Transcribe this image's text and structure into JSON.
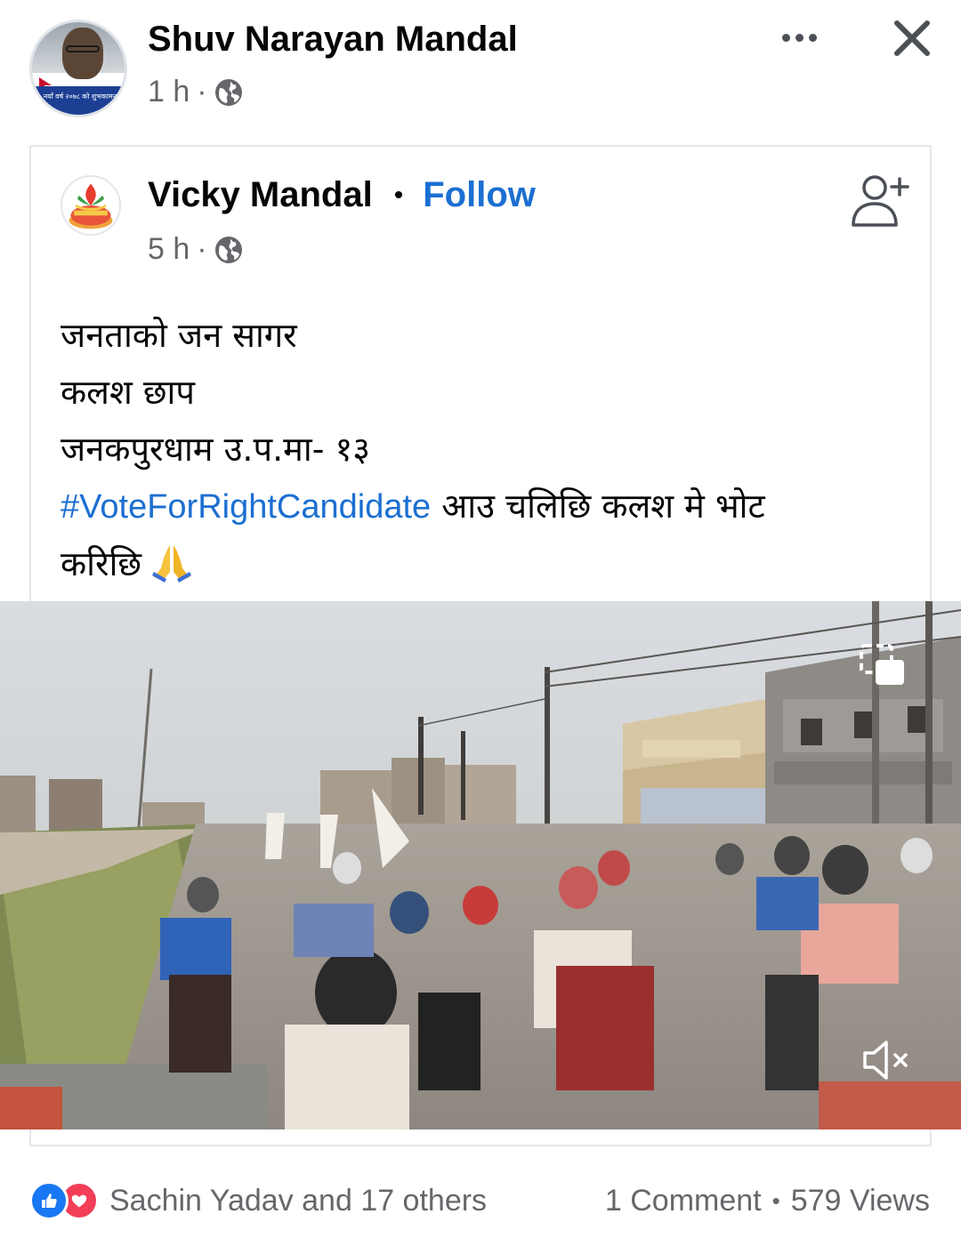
{
  "post": {
    "author_name": "Shuv Narayan Mandal",
    "time": "1 h",
    "meta_separator": "·",
    "avatar_banner_text": "नयाँ वर्ष २०७८ को शुभकामना"
  },
  "shared_post": {
    "author_name": "Vicky Mandal",
    "name_separator": "•",
    "follow_label": "Follow",
    "time": "5 h",
    "meta_separator": "·",
    "lines": [
      "जनताको जन सागर",
      "कलश छाप",
      "जनकपुरधाम उ.प.मा- १३"
    ],
    "hashtag": "#VoteForRightCandidate",
    "hashtag_trailing_text": " आउ चलिछि कलश मे भोट",
    "last_line": "करिछि",
    "emoji": "pray-icon"
  },
  "footer": {
    "reactions_text": "Sachin Yadav and 17 others",
    "comments_text": "1 Comment",
    "stats_separator": "•",
    "views_text": "579 Views"
  },
  "icons": {
    "more": "more-options-icon",
    "close": "close-icon",
    "privacy": "globe-icon",
    "add_friend": "add-friend-icon",
    "pip": "picture-in-picture-icon",
    "mute": "mute-icon",
    "like": "like-reaction-icon",
    "love": "love-reaction-icon"
  },
  "colors": {
    "link_blue": "#1b6fd1",
    "secondary_text": "#65676b",
    "like_blue": "#1877f2",
    "love_red": "#f33e58"
  }
}
